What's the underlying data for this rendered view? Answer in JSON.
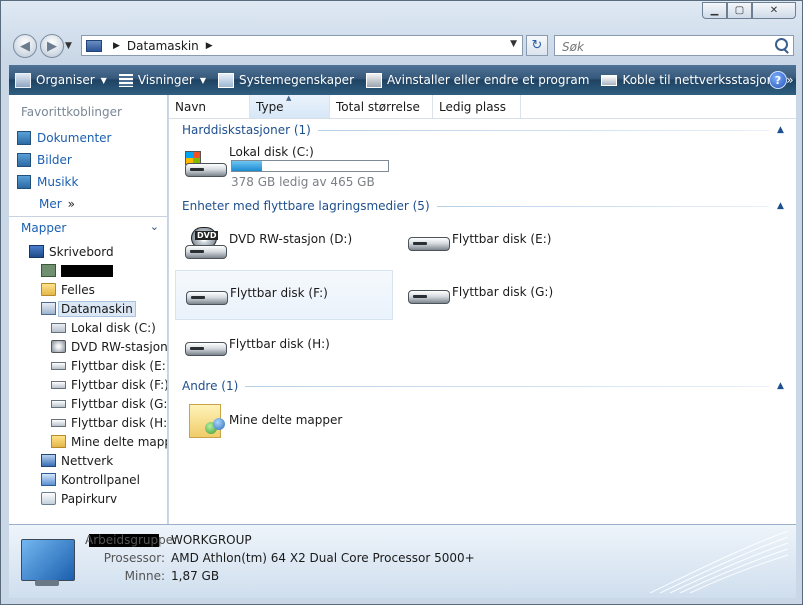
{
  "address": {
    "location": "Datamaskin"
  },
  "search": {
    "placeholder": "Søk"
  },
  "toolbar": {
    "organize": "Organiser",
    "views": "Visninger",
    "properties": "Systemegenskaper",
    "uninstall": "Avinstaller eller endre et program",
    "mapdrive": "Koble til nettverksstasjon",
    "more": "»",
    "help": "?"
  },
  "nav": {
    "favorites_title": "Favorittkoblinger",
    "favorites": [
      "Dokumenter",
      "Bilder",
      "Musikk"
    ],
    "more_label": "Mer",
    "more_arrow": "»",
    "folders_title": "Mapper",
    "tree": {
      "desktop": "Skrivebord",
      "public": "Felles",
      "computer": "Datamaskin",
      "drive_c": "Lokal disk (C:)",
      "drive_d": "DVD RW-stasjon (",
      "drive_e": "Flyttbar disk (E:)",
      "drive_f": "Flyttbar disk (F:)",
      "drive_g": "Flyttbar disk (G:)",
      "drive_h": "Flyttbar disk (H:)",
      "shared": "Mine delte mappe",
      "network": "Nettverk",
      "controlpanel": "Kontrollpanel",
      "recyclebin": "Papirkurv"
    }
  },
  "columns": [
    "Navn",
    "Type",
    "Total størrelse",
    "Ledig plass"
  ],
  "groups": {
    "hdd": "Harddiskstasjoner (1)",
    "removable": "Enheter med flyttbare lagringsmedier (5)",
    "other": "Andre (1)"
  },
  "items": {
    "drive_c": {
      "name": "Lokal disk (C:)",
      "free": "378 GB ledig av 465 GB",
      "used_fraction": 0.19
    },
    "drive_d": {
      "name": "DVD RW-stasjon (D:)",
      "badge": "DVD"
    },
    "drive_e": {
      "name": "Flyttbar disk (E:)"
    },
    "drive_f": {
      "name": "Flyttbar disk (F:)"
    },
    "drive_g": {
      "name": "Flyttbar disk (G:)"
    },
    "drive_h": {
      "name": "Flyttbar disk (H:)"
    },
    "shared": {
      "name": "Mine delte mapper"
    }
  },
  "details": {
    "workgroup_label": "Arbeidsgruppe:",
    "workgroup": "WORKGROUP",
    "processor_label": "Prosessor:",
    "processor": "AMD Athlon(tm) 64 X2 Dual Core Processor 5000+",
    "memory_label": "Minne:",
    "memory": "1,87 GB"
  }
}
